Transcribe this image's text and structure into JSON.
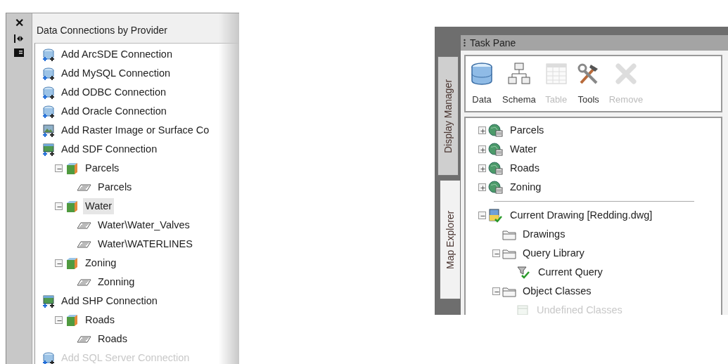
{
  "data_connect": {
    "side_buttons": [
      {
        "kind": "close",
        "label": "✕"
      },
      {
        "kind": "dock"
      },
      {
        "kind": "panel"
      }
    ],
    "title": "Data Connections by Provider",
    "items": [
      {
        "kind": "database",
        "label": "Add ArcSDE Connection",
        "disabled": false
      },
      {
        "kind": "database",
        "label": "Add MySQL Connection",
        "disabled": false
      },
      {
        "kind": "database",
        "label": "Add ODBC Connection",
        "disabled": false
      },
      {
        "kind": "database",
        "label": "Add Oracle Connection",
        "disabled": false
      },
      {
        "kind": "raster",
        "label": "Add Raster Image or Surface Co",
        "disabled": false
      },
      {
        "kind": "file",
        "label": "Add SDF Connection",
        "disabled": false,
        "children": [
          {
            "kind": "source",
            "label": "Parcels",
            "expanded": true,
            "selected": false,
            "children": [
              {
                "kind": "class",
                "label": "Parcels"
              }
            ]
          },
          {
            "kind": "source",
            "label": "Water",
            "expanded": true,
            "selected": true,
            "children": [
              {
                "kind": "class",
                "label": "Water\\Water_Valves"
              },
              {
                "kind": "class",
                "label": "Water\\WATERLINES"
              }
            ]
          },
          {
            "kind": "source",
            "label": "Zoning",
            "expanded": true,
            "selected": false,
            "children": [
              {
                "kind": "class",
                "label": "Zonning"
              }
            ]
          }
        ]
      },
      {
        "kind": "file",
        "label": "Add SHP Connection",
        "disabled": false,
        "children": [
          {
            "kind": "source",
            "label": "Roads",
            "expanded": true,
            "selected": false,
            "children": [
              {
                "kind": "class",
                "label": "Roads"
              }
            ]
          }
        ]
      },
      {
        "kind": "database",
        "label": "Add SQL Server Connection",
        "disabled": true
      }
    ]
  },
  "task_pane": {
    "title": "Task Pane",
    "tabs": [
      {
        "label": "Display Manager",
        "selected": false
      },
      {
        "label": "Map Explorer",
        "selected": true
      }
    ],
    "toolbar": [
      {
        "kind": "data",
        "label": "Data",
        "disabled": false
      },
      {
        "kind": "schema",
        "label": "Schema",
        "disabled": false
      },
      {
        "kind": "table",
        "label": "Table",
        "disabled": true
      },
      {
        "kind": "tools",
        "label": "Tools",
        "disabled": false
      },
      {
        "kind": "remove",
        "label": "Remove",
        "disabled": true
      }
    ],
    "layers": [
      {
        "kind": "layer",
        "label": "Parcels",
        "expanded": false
      },
      {
        "kind": "layer",
        "label": "Water",
        "expanded": false
      },
      {
        "kind": "layer",
        "label": "Roads",
        "expanded": false
      },
      {
        "kind": "layer",
        "label": "Zoning",
        "expanded": false
      }
    ],
    "explorer": [
      {
        "kind": "drawing",
        "label": "Current Drawing [Redding.dwg]",
        "expanded": true,
        "children": [
          {
            "kind": "folder",
            "label": "Drawings"
          },
          {
            "kind": "folder",
            "label": "Query Library",
            "expanded": true,
            "children": [
              {
                "kind": "query",
                "label": "Current Query"
              }
            ]
          },
          {
            "kind": "folder",
            "label": "Object Classes",
            "expanded": true,
            "children": [
              {
                "kind": "classes",
                "label": "Undefined Classes",
                "disabled": true
              }
            ]
          }
        ]
      }
    ]
  }
}
